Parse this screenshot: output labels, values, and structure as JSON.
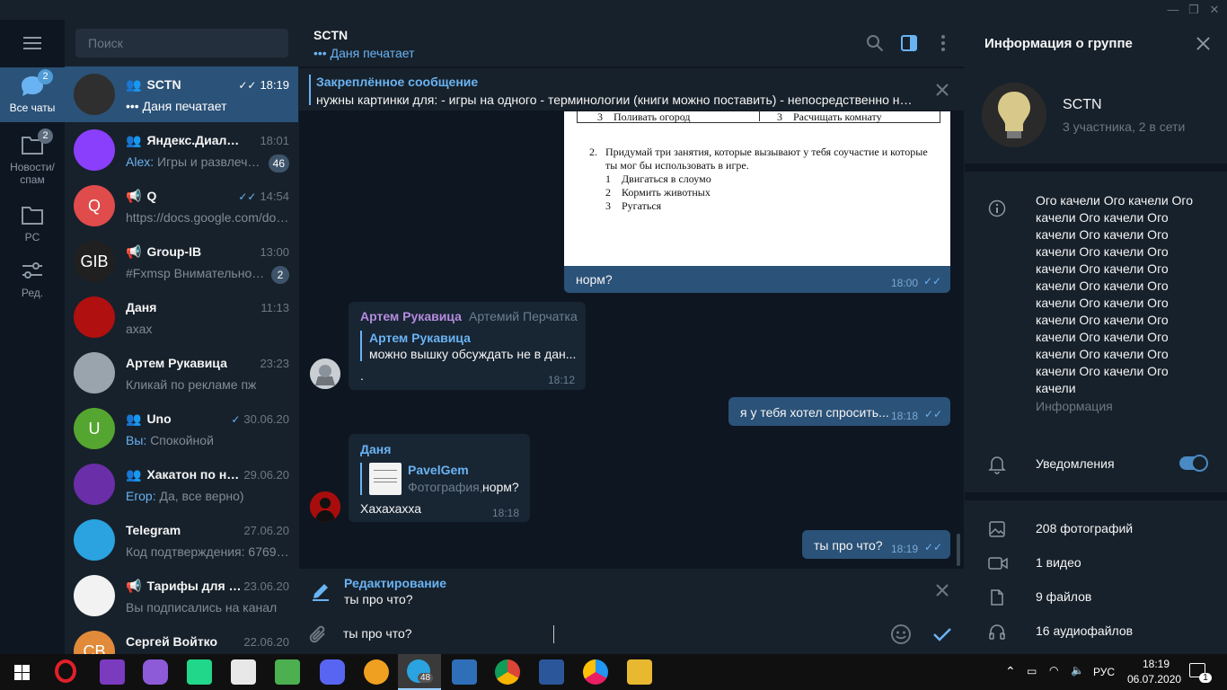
{
  "window": {
    "minimize": "—",
    "maximize": "❐",
    "close": "✕"
  },
  "rail": {
    "folders": [
      {
        "label": "Все чаты",
        "badge": "2"
      },
      {
        "label": "Новости/\nспам",
        "badge": "2"
      },
      {
        "label": "PC",
        "badge": ""
      },
      {
        "label": "Ред.",
        "badge": ""
      }
    ]
  },
  "search": {
    "placeholder": "Поиск"
  },
  "chats": [
    {
      "name": "SCTN",
      "time": "18:19",
      "msg": "••• Даня печатает",
      "who": "",
      "unread": "",
      "icon": "group",
      "ticks": "✓✓",
      "avatar": "#2f2f2f",
      "letter": ""
    },
    {
      "name": "Яндекс.Диалоги (...",
      "time": "18:01",
      "msg": "Игры и развлечен...",
      "who": "Alex: ",
      "unread": "46",
      "icon": "group",
      "ticks": "",
      "avatar": "#8a3ffc",
      "letter": ""
    },
    {
      "name": "Q",
      "time": "14:54",
      "msg": "https://docs.google.com/doc...",
      "who": "",
      "unread": "",
      "icon": "channel",
      "ticks": "✓✓",
      "avatar": "#e04b4b",
      "letter": "Q"
    },
    {
      "name": "Group-IB",
      "time": "13:00",
      "msg": "#Fxmsp Внимательно и...",
      "who": "",
      "unread": "2",
      "icon": "channel",
      "ticks": "",
      "avatar": "#202020",
      "letter": "GIB"
    },
    {
      "name": "Даня",
      "time": "11:13",
      "msg": "ахах",
      "who": "",
      "unread": "",
      "icon": "",
      "ticks": "",
      "avatar": "#b01010",
      "letter": ""
    },
    {
      "name": "Артем Рукавица",
      "time": "23:23",
      "msg": "Кликай по рекламе пж",
      "who": "",
      "unread": "",
      "icon": "",
      "ticks": "",
      "avatar": "#9aa4ad",
      "letter": ""
    },
    {
      "name": "Uno",
      "time": "30.06.20",
      "msg": "Спокойной",
      "who": "Вы: ",
      "unread": "",
      "icon": "group",
      "ticks": "✓",
      "avatar": "#55a630",
      "letter": "U"
    },
    {
      "name": "Хакатон по на...",
      "time": "29.06.20",
      "msg": "Да, все верно)",
      "who": "Егор: ",
      "unread": "",
      "icon": "group",
      "ticks": "",
      "avatar": "#6a2ea8",
      "letter": ""
    },
    {
      "name": "Telegram",
      "time": "27.06.20",
      "msg": "Код подтверждения: 67691. ...",
      "who": "",
      "unread": "",
      "icon": "",
      "ticks": "",
      "avatar": "#2aa3e0",
      "letter": ""
    },
    {
      "name": "Тарифы для с...",
      "time": "23.06.20",
      "msg": "Вы подписались на канал",
      "who": "",
      "unread": "",
      "icon": "channel",
      "ticks": "",
      "avatar": "#f2f2f2",
      "letter": ""
    },
    {
      "name": "Сергей Войтко",
      "time": "22.06.20",
      "msg": "",
      "who": "",
      "unread": "",
      "icon": "",
      "ticks": "",
      "avatar": "#e08a3a",
      "letter": "СВ"
    }
  ],
  "header": {
    "title": "SCTN",
    "status": "••• Даня печатает"
  },
  "pinned": {
    "title": "Закреплённое сообщение",
    "text": "нужны картинки для: - игры на одного - терминологии (книги можно поставить) - непосредственно нав..."
  },
  "doc": {
    "row_left": "3    Поливать огород",
    "row_right": "3    Расчищать комнату",
    "q_line1": "2.   Придумай три занятия, которые вызывают у тебя соучастие и которые",
    "q_line2": "ты мог бы использовать в игре.",
    "items": [
      "1    Двигаться в слоумо",
      "2    Кормить животных",
      "3    Ругаться"
    ]
  },
  "messages": {
    "m1": {
      "text": "норм?",
      "time": "18:00"
    },
    "m2": {
      "author": "Артем Рукавица",
      "via": "Артемий Перчатка",
      "reply_author": "Артем Рукавица",
      "reply_text": "можно вышку обсуждать не в дан...",
      "text": ".",
      "time": "18:12"
    },
    "m3": {
      "text": "я у тебя хотел спросить...",
      "time": "18:18"
    },
    "m4": {
      "author": "Даня",
      "reply_author": "PavelGem",
      "reply_kind": "Фотография,",
      "reply_text": "норм?",
      "text": "Хахахахха",
      "time": "18:18"
    },
    "m5": {
      "text": "ты про что?",
      "time": "18:19"
    }
  },
  "compose": {
    "edit_title": "Редактирование",
    "edit_text": "ты про что?",
    "input": "ты про что?"
  },
  "info": {
    "title": "Информация о группе",
    "name": "SCTN",
    "members": "3 участника, 2 в сети",
    "description_lines": [
      "Ого качели Ого качели Ого",
      "качели Ого качели Ого",
      "качели Ого качели Ого",
      "качели Ого качели Ого",
      "качели Ого качели Ого",
      "качели Ого качели Ого",
      "качели Ого качели Ого",
      "качели Ого качели Ого",
      "качели Ого качели Ого",
      "качели Ого качели Ого",
      "качели Ого качели Ого",
      "качели"
    ],
    "desc_label": "Информация",
    "notifications": "Уведомления",
    "notifications_on": true,
    "media": [
      "208 фотографий",
      "1 видео",
      "9 файлов",
      "16 аудиофайлов"
    ]
  },
  "taskbar": {
    "lang": "РУС",
    "time": "18:19",
    "date": "06.07.2020",
    "telegram_badge": "48",
    "notif_count": "1"
  },
  "colors": {
    "accent": "#6ab3f3",
    "active": "#2b5278",
    "bg": "#0e1621",
    "panel": "#17212b"
  }
}
